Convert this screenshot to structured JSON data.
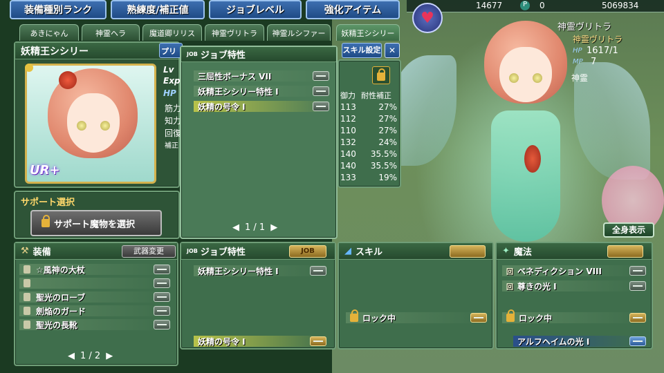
{
  "top_buttons": [
    "装備種別ランク",
    "熟練度/補正値",
    "ジョブレベル",
    "強化アイテム"
  ],
  "resources": {
    "count1": "14677",
    "count2": "0",
    "gold": "5069834",
    "p_label": "P"
  },
  "tabs": [
    "あきにゃん",
    "神霊ヘラ",
    "魔道卿リリス",
    "神霊ヴリトラ",
    "神霊ルシファー",
    "妖精王シシリー"
  ],
  "character": {
    "name": "妖精王シシリー",
    "rarity": "UR+",
    "stat_labels": [
      "Lv",
      "Exp",
      "HP",
      "筋力",
      "知力",
      "回復",
      "補正"
    ]
  },
  "preset_button": "プリセ",
  "skill_settings": "スキル設定",
  "close": "✕",
  "job_popup": {
    "title": "ジョブ特性",
    "job_prefix": "JOB",
    "items": [
      "三屈性ボーナス VII",
      "妖精王シシリー特性 I",
      "妖精の号令 I"
    ],
    "page": "1 / 1"
  },
  "defense_table": {
    "headers": [
      "御力",
      "耐性補正"
    ],
    "rows": [
      [
        "113",
        "27%"
      ],
      [
        "112",
        "27%"
      ],
      [
        "110",
        "27%"
      ],
      [
        "132",
        "24%"
      ],
      [
        "140",
        "35.5%"
      ],
      [
        "140",
        "35.5%"
      ],
      [
        "133",
        "19%"
      ]
    ]
  },
  "support": {
    "title": "サポート選択",
    "button": "サポート魔物を選択"
  },
  "equipment": {
    "title": "装備",
    "change_button": "武器変更",
    "items": [
      "☆風神の大杖",
      "",
      "聖光のローブ",
      "劍焔のガード",
      "聖光の長靴"
    ],
    "page": "1 / 2"
  },
  "job_panel": {
    "title": "ジョブ特性",
    "items": [
      "妖精王シシリー特性 I",
      "妖精の号令 I"
    ],
    "badge": "JOB"
  },
  "skill_panel": {
    "title": "スキル",
    "locked": "ロック中"
  },
  "magic_panel": {
    "title": "魔法",
    "items": [
      "ベネディクション VIII",
      "尊きの光 I"
    ],
    "prefix": "回",
    "locked": "ロック中",
    "bottom": "アルフヘイムの光 I"
  },
  "right_info": {
    "name": "神霊ヴリトラ",
    "label_hp": "HP",
    "hp": "1617/1",
    "label_mp": "MP",
    "mp": "7",
    "other": "神霊",
    "fullview": "全身表示"
  }
}
